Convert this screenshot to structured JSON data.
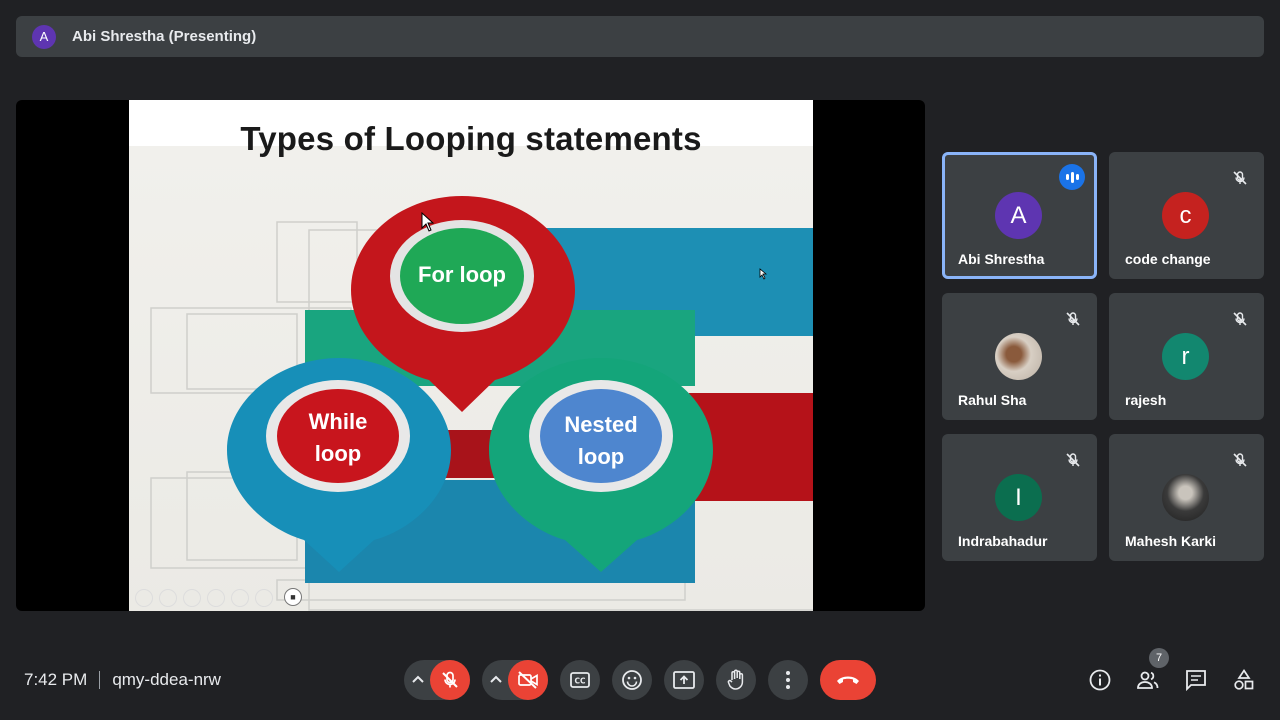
{
  "presenter": {
    "initial": "A",
    "label": "Abi Shrestha (Presenting)"
  },
  "slide": {
    "title": "Types of Looping statements",
    "bubbles": [
      {
        "line1": "For loop",
        "line2": ""
      },
      {
        "line1": "While",
        "line2": "loop"
      },
      {
        "line1": "Nested",
        "line2": "loop"
      }
    ]
  },
  "participants": [
    {
      "initial": "A",
      "name": "Abi Shrestha",
      "color": "#5e35b1",
      "speaking": true
    },
    {
      "initial": "c",
      "name": "code change",
      "color": "#c5221f",
      "speaking": false
    },
    {
      "initial": "",
      "name": "Rahul Sha",
      "color": "#c8b8a6",
      "speaking": false
    },
    {
      "initial": "r",
      "name": "rajesh",
      "color": "#12876f",
      "speaking": false
    },
    {
      "initial": "I",
      "name": "Indrabahadur",
      "color": "#0b6e4f",
      "speaking": false
    },
    {
      "initial": "",
      "name": "Mahesh Karki",
      "color": "#4a4a4a",
      "speaking": false
    }
  ],
  "meeting": {
    "time": "7:42 PM",
    "code": "qmy-ddea-nrw",
    "people_count": "7"
  },
  "colors": {
    "red": "#ea4335",
    "blue_active": "#8ab4f8",
    "panel": "#3c4043"
  }
}
